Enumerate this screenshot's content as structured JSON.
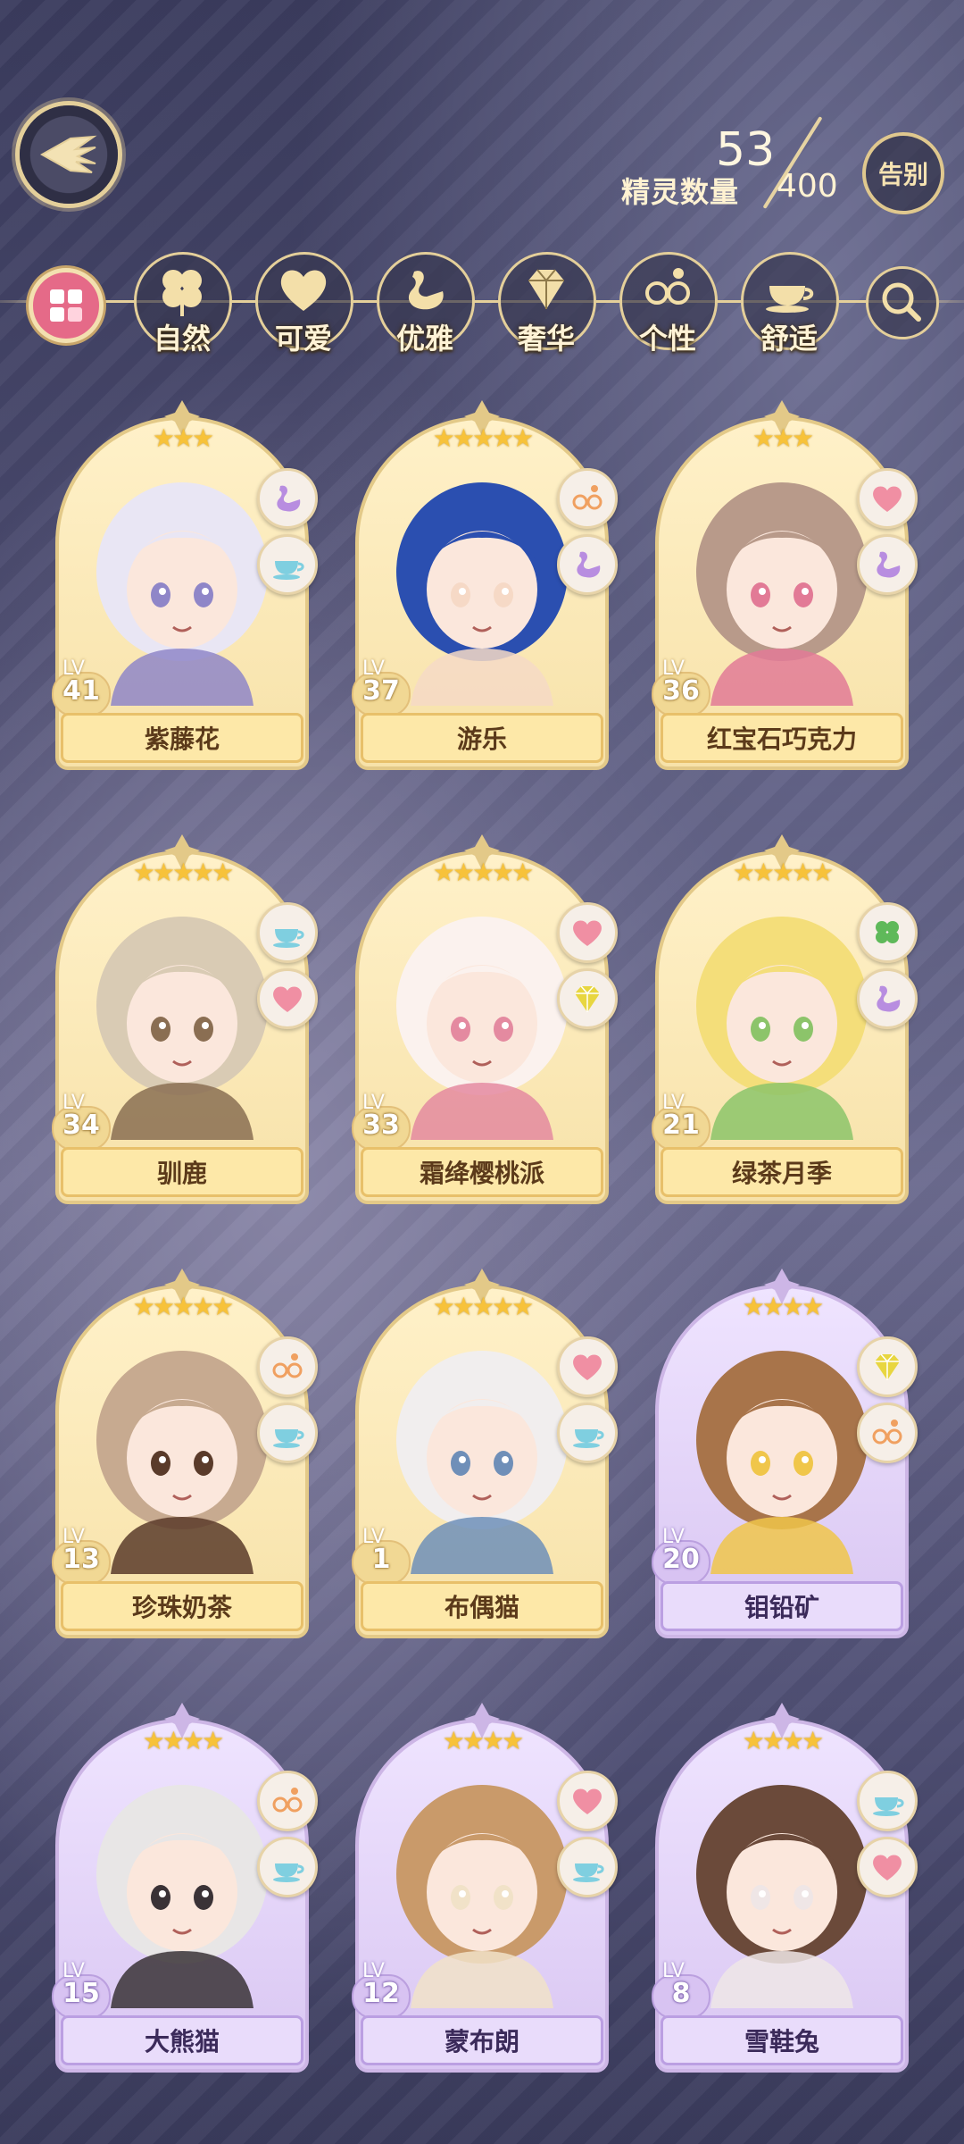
{
  "header": {
    "count_label": "精灵数量",
    "count_current": "53",
    "count_max": "400",
    "farewell_label": "告别"
  },
  "filters": [
    {
      "name": "nature",
      "label": "自然",
      "icon": "clover-icon"
    },
    {
      "name": "cute",
      "label": "可爱",
      "icon": "heart-icon"
    },
    {
      "name": "elegant",
      "label": "优雅",
      "icon": "swan-icon"
    },
    {
      "name": "luxury",
      "label": "奢华",
      "icon": "diamond-icon"
    },
    {
      "name": "personality",
      "label": "个性",
      "icon": "glasses-icon"
    },
    {
      "name": "comfort",
      "label": "舒适",
      "icon": "teacup-icon"
    }
  ],
  "cards": [
    {
      "name": "紫藤花",
      "lv": "41",
      "stars": 3,
      "max_stars": 5,
      "rarity": "gold",
      "tags": [
        "swan-icon",
        "teacup-icon"
      ]
    },
    {
      "name": "游乐",
      "lv": "37",
      "stars": 5,
      "max_stars": 5,
      "rarity": "gold",
      "tags": [
        "glasses-icon",
        "swan-icon"
      ]
    },
    {
      "name": "红宝石巧克力",
      "lv": "36",
      "stars": 3,
      "max_stars": 5,
      "rarity": "gold",
      "tags": [
        "heart-icon",
        "swan-icon"
      ]
    },
    {
      "name": "驯鹿",
      "lv": "34",
      "stars": 5,
      "max_stars": 5,
      "rarity": "gold",
      "tags": [
        "teacup-icon",
        "heart-icon"
      ]
    },
    {
      "name": "霜绛樱桃派",
      "lv": "33",
      "stars": 5,
      "max_stars": 5,
      "rarity": "gold",
      "tags": [
        "heart-icon",
        "diamond-icon"
      ]
    },
    {
      "name": "绿茶月季",
      "lv": "21",
      "stars": 5,
      "max_stars": 5,
      "rarity": "gold",
      "tags": [
        "clover-icon",
        "swan-icon"
      ]
    },
    {
      "name": "珍珠奶茶",
      "lv": "13",
      "stars": 5,
      "max_stars": 5,
      "rarity": "gold",
      "tags": [
        "glasses-icon",
        "teacup-icon"
      ]
    },
    {
      "name": "布偶猫",
      "lv": "1",
      "stars": 5,
      "max_stars": 5,
      "rarity": "gold",
      "tags": [
        "heart-icon",
        "teacup-icon"
      ]
    },
    {
      "name": "钼铅矿",
      "lv": "20",
      "stars": 4,
      "max_stars": 4,
      "rarity": "purple",
      "tags": [
        "diamond-icon",
        "glasses-icon"
      ]
    },
    {
      "name": "大熊猫",
      "lv": "15",
      "stars": 4,
      "max_stars": 4,
      "rarity": "purple",
      "tags": [
        "glasses-icon",
        "teacup-icon"
      ]
    },
    {
      "name": "蒙布朗",
      "lv": "12",
      "stars": 4,
      "max_stars": 4,
      "rarity": "purple",
      "tags": [
        "heart-icon",
        "teacup-icon"
      ]
    },
    {
      "name": "雪鞋兔",
      "lv": "8",
      "stars": 4,
      "max_stars": 4,
      "rarity": "purple",
      "tags": [
        "teacup-icon",
        "heart-icon"
      ]
    }
  ],
  "lv_prefix": "LV",
  "colors": {
    "gold_frame": "#e3c988",
    "purple_frame": "#cdb6e6",
    "accent_pink": "#e56a88",
    "tag_pink": "#f08fa3",
    "tag_purple": "#b88de0",
    "tag_cyan": "#7fcfe0",
    "tag_green": "#5fb95a",
    "tag_yellow": "#e8d640",
    "tag_orange": "#f0a060"
  }
}
